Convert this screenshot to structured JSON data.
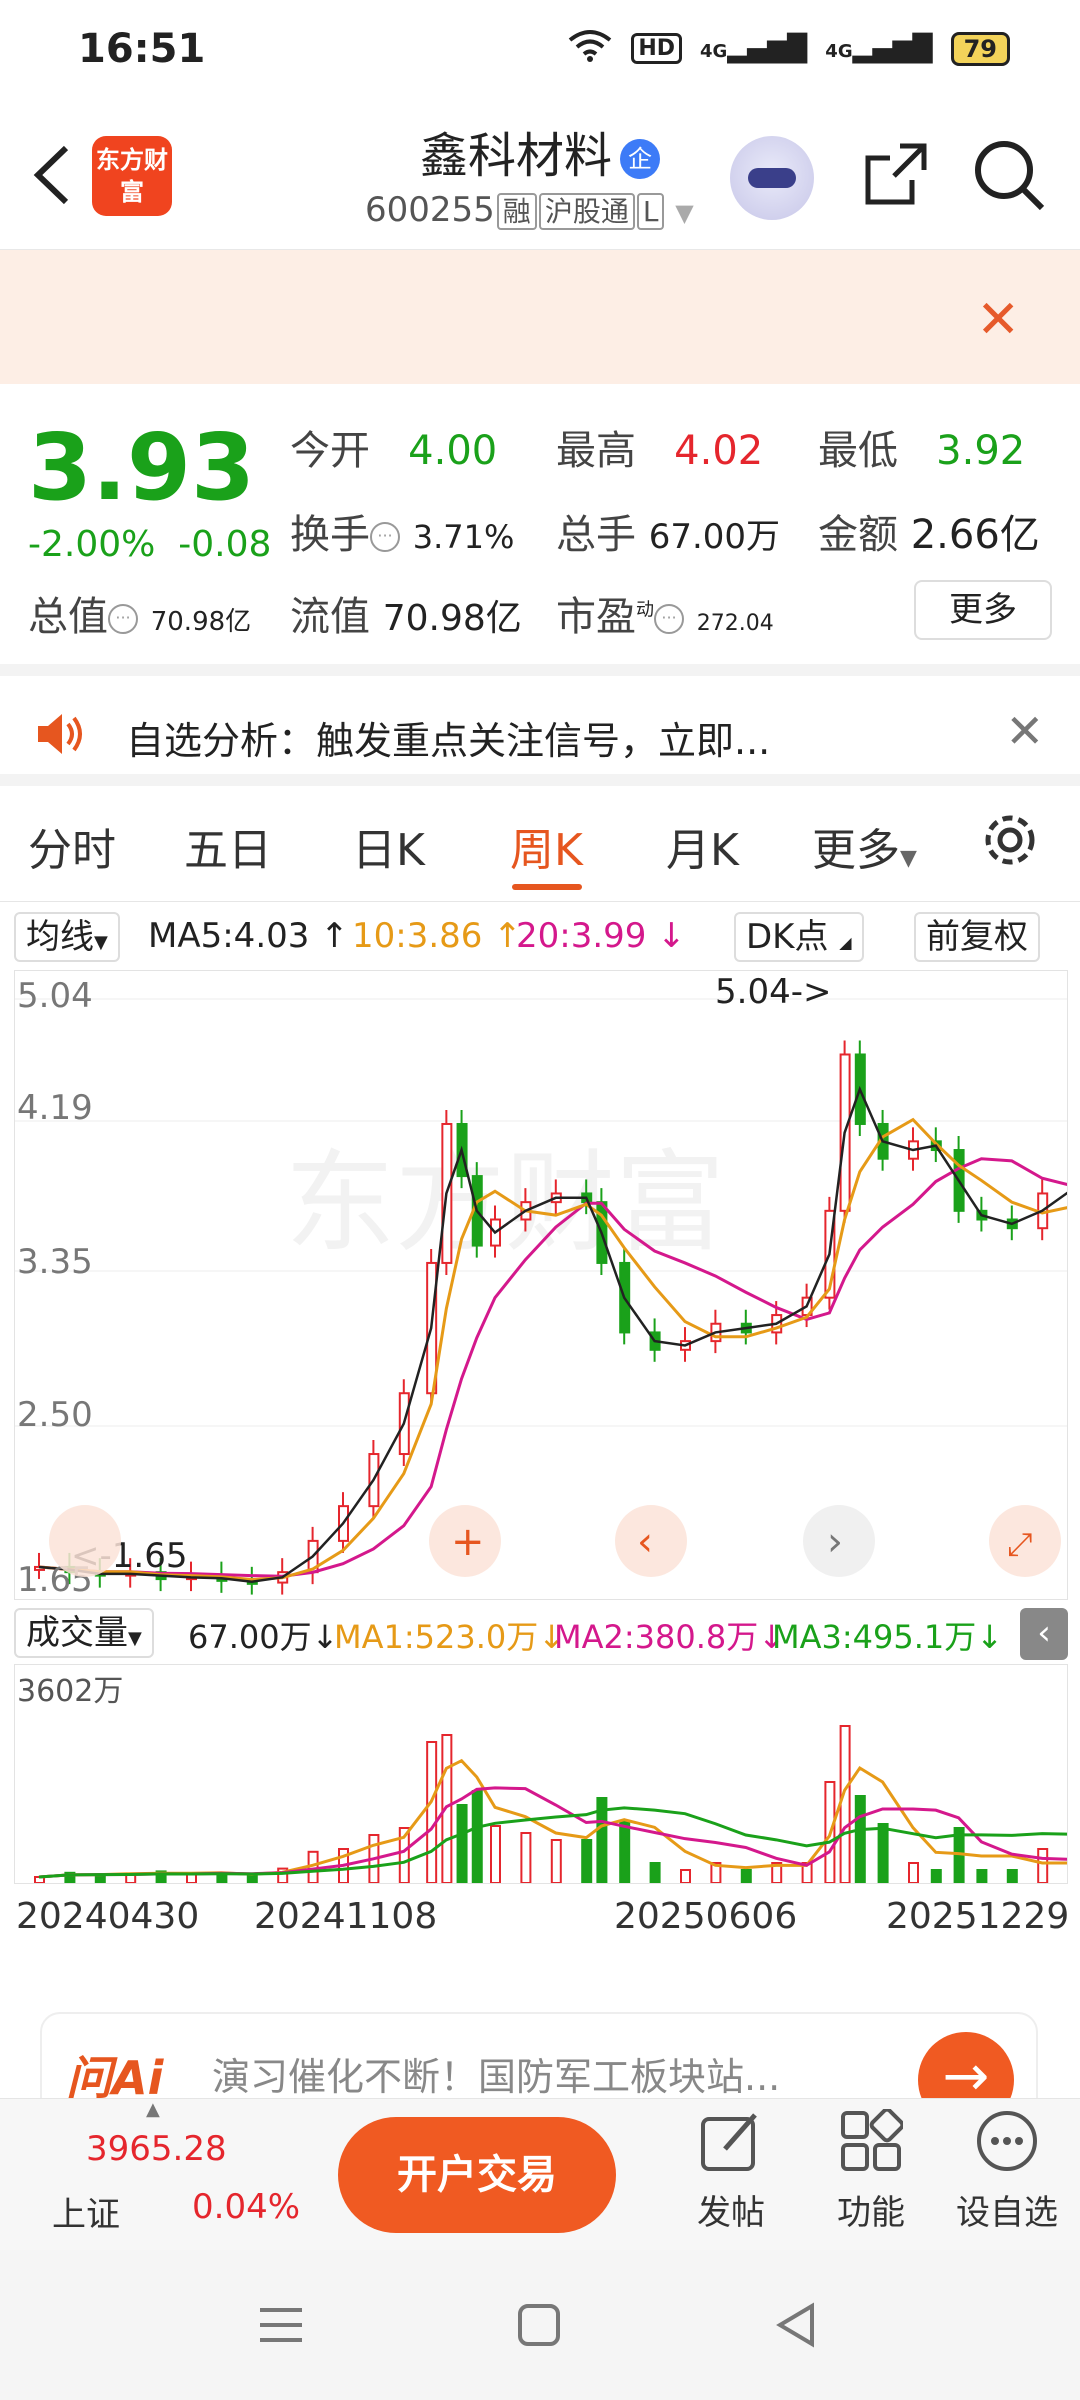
{
  "status_bar": {
    "time": "16:51",
    "hd": "HD",
    "sig1": "4G",
    "sig2": "4G",
    "battery": "79"
  },
  "header": {
    "app_logo": "东方财富",
    "stock_name": "鑫科材料",
    "badge": "企",
    "code": "600255",
    "tag1": "融",
    "tag2": "沪股通",
    "tag3": "L"
  },
  "quote": {
    "price": "3.93",
    "change_pct": "-2.00%",
    "change": "-0.08",
    "open_label": "今开",
    "open": "4.00",
    "high_label": "最高",
    "high": "4.02",
    "low_label": "最低",
    "low": "3.92",
    "turnover_label": "换手",
    "turnover": "3.71%",
    "volume_label": "总手",
    "volume": "67.00万",
    "amount_label": "金额",
    "amount": "2.66亿",
    "mktcap_label": "总值",
    "mktcap": "70.98亿",
    "float_label": "流值",
    "float": "70.98亿",
    "pe_label": "市盈",
    "pe_sup": "动",
    "pe": "272.04",
    "more": "更多"
  },
  "notice": {
    "text": "自选分析：触发重点关注信号，立即..."
  },
  "tabs": [
    "分时",
    "五日",
    "日K",
    "周K",
    "月K",
    "更多"
  ],
  "ma_line": {
    "type": "均线",
    "ma5": "MA5:4.03",
    "ma10": "10:3.86",
    "ma20": "20:3.99",
    "dk": "DK点",
    "adjust": "前复权"
  },
  "kchart": {
    "y_labels": [
      "5.04",
      "4.19",
      "3.35",
      "2.50",
      "1.65"
    ],
    "high_mark": "5.04->",
    "low_mark": "<-1.65"
  },
  "volume_head": {
    "type": "成交量",
    "vol": "67.00万",
    "ma1": "MA1:523.0万",
    "ma2": "MA2:380.8万",
    "ma3": "MA3:495.1万",
    "max": "3602万"
  },
  "dates": [
    "20240430",
    "20241108",
    "20250606",
    "20251229"
  ],
  "ai_banner": {
    "logo": "问Ai",
    "text": "演习催化不断！国防军工板块站..."
  },
  "bottom": {
    "index_value": "3965.28",
    "index_name": "上证",
    "index_pct": "0.04%",
    "open_account": "开户交易",
    "post": "发帖",
    "func": "功能",
    "watch": "设自选"
  },
  "colors": {
    "up": "#e5262d",
    "down": "#1aa11a",
    "accent": "#e6561f"
  }
}
